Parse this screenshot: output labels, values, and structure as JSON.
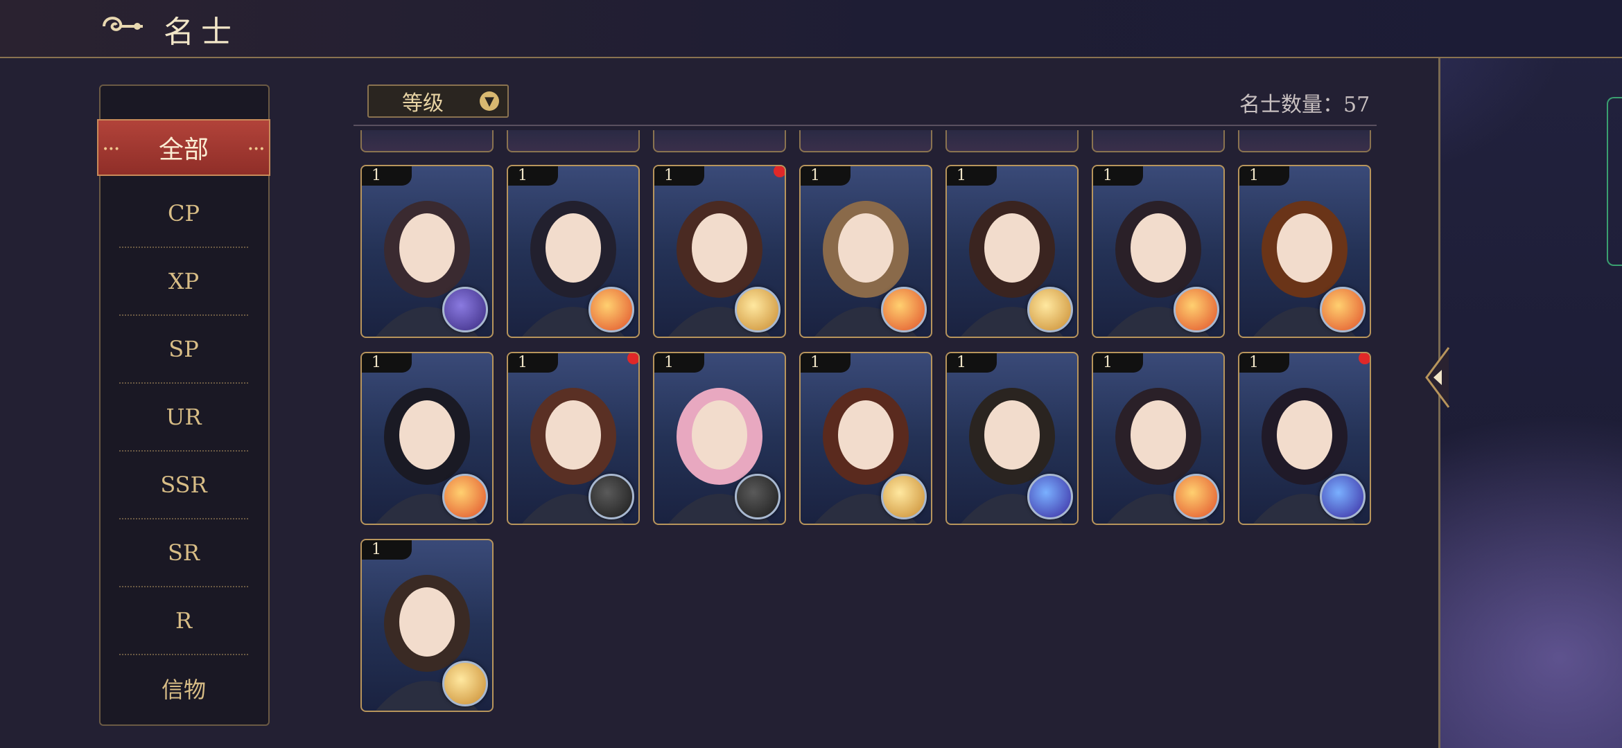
{
  "header": {
    "title": "名士"
  },
  "sidebar": {
    "items": [
      {
        "label": "全部",
        "active": true
      },
      {
        "label": "CP"
      },
      {
        "label": "XP"
      },
      {
        "label": "SP"
      },
      {
        "label": "UR"
      },
      {
        "label": "SSR"
      },
      {
        "label": "SR"
      },
      {
        "label": "R"
      },
      {
        "label": "信物"
      }
    ]
  },
  "toolbar": {
    "sort_label": "等级",
    "count_text": "名士数量：57"
  },
  "colors": {
    "accent_red": "#a83a32",
    "gold": "#b8955c",
    "panel": "#232033"
  },
  "cards": [
    {
      "level": "1",
      "element": "purple-moon-icon",
      "badge": false
    },
    {
      "level": "1",
      "element": "fire-orb-icon",
      "badge": false
    },
    {
      "level": "1",
      "element": "gold-orb-icon",
      "badge": true
    },
    {
      "level": "1",
      "element": "fire-orb-icon",
      "badge": false
    },
    {
      "level": "1",
      "element": "gold-orb-icon",
      "badge": false
    },
    {
      "level": "1",
      "element": "fire-orb-icon",
      "badge": false
    },
    {
      "level": "1",
      "element": "fire-orb-icon",
      "badge": false
    },
    {
      "level": "1",
      "element": "fire-orb-icon",
      "badge": false
    },
    {
      "level": "1",
      "element": "compass-icon",
      "badge": true
    },
    {
      "level": "1",
      "element": "compass-icon",
      "badge": false
    },
    {
      "level": "1",
      "element": "gold-orb-icon",
      "badge": false
    },
    {
      "level": "1",
      "element": "blue-star-orb-icon",
      "badge": false
    },
    {
      "level": "1",
      "element": "fire-orb-icon",
      "badge": false
    },
    {
      "level": "1",
      "element": "blue-star-orb-icon",
      "badge": true
    },
    {
      "level": "1",
      "element": "gold-orb-icon",
      "badge": false
    }
  ]
}
